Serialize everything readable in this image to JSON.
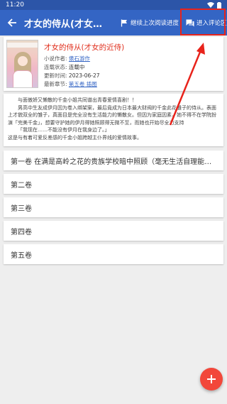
{
  "status": {
    "time": "11:20"
  },
  "appbar": {
    "title": "才女的侍从(才女的近侍)",
    "continue_label": "继续上次阅读进度",
    "comments_label": "进入评论区"
  },
  "book": {
    "title": "才女的侍从(才女的近侍)",
    "author_label": "小说作者:",
    "author": "俵石游作",
    "state_label": "连载状态:",
    "state": "连载中",
    "updated_label": "更新时间:",
    "updated": "2023-06-27",
    "latest_label": "最新章节:",
    "latest": "第五卷 插图"
  },
  "description": [
    "与面傲娇又懒散的千金小姐共同谱出青春爱情喜剧！！",
    "男高中生友成伊月因为卷入绑架案，最后竟成为日本最大财阀的千金此花雏子的侍从。表面",
    "上才貌双全的雏子，真面目是完全没有生活能力的懒散女。但因为家庭因素，她不得不在学院扮",
    "演「完美千金」，想要守护她的伊月得她照顾得无微不至，而她也开始尽全力支持",
    "「我现在……不能没有伊月在我身边了。」",
    "这是与有着可爱反差感的千金小姐跨越主仆界线的爱情故事。"
  ],
  "volumes": [
    "第一卷 在满是高岭之花的贵族学校暗中照顾（毫无生活自理能力的千金小姐",
    "第二卷",
    "第三卷",
    "第四卷",
    "第五卷"
  ],
  "colors": {
    "appbar": "#3465c4",
    "title_red": "#e0301e",
    "annotation_red": "#e8231b",
    "fab": "#f2473a"
  },
  "icons": {
    "back": "arrow-left-icon",
    "continue": "flag-icon",
    "comments": "chat-bubble-icon",
    "fab": "plus-icon"
  }
}
